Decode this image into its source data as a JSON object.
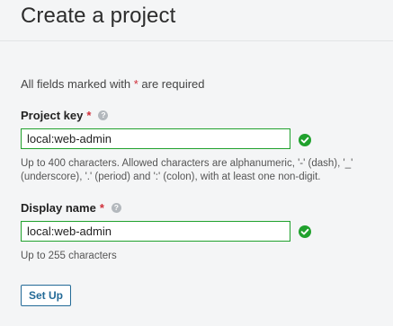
{
  "header": {
    "title": "Create a project"
  },
  "form": {
    "required_note_prefix": "All fields marked with ",
    "required_star": "*",
    "required_note_suffix": " are required",
    "project_key": {
      "label": "Project key",
      "required_star": "*",
      "help_icon": "?",
      "value": "local:web-admin",
      "status": "valid",
      "help": "Up to 400 characters. Allowed characters are alphanumeric, '-' (dash), '_' (underscore), '.' (period) and ':' (colon), with at least one non-digit."
    },
    "display_name": {
      "label": "Display name",
      "required_star": "*",
      "help_icon": "?",
      "value": "local:web-admin",
      "status": "valid",
      "help": "Up to 255 characters"
    },
    "submit_label": "Set Up"
  },
  "colors": {
    "required": "#d02f3a",
    "valid": "#20a12d",
    "button": "#236a97"
  },
  "icons": {
    "help": "question-circle-icon",
    "valid": "check-circle-icon"
  }
}
